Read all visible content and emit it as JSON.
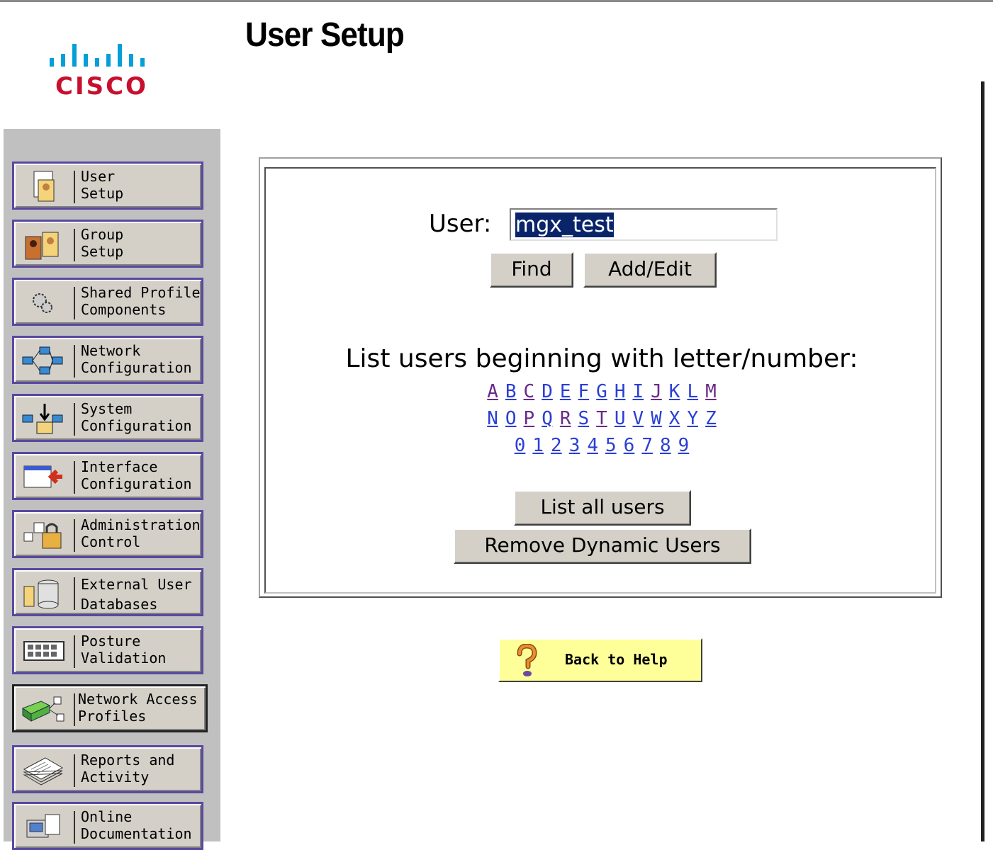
{
  "page": {
    "title": "User Setup"
  },
  "logo": {
    "text": "CISCO"
  },
  "sidebar": {
    "items": [
      {
        "label": "User\nSetup",
        "icon": "user-setup-icon"
      },
      {
        "label": "Group\nSetup",
        "icon": "group-setup-icon"
      },
      {
        "label": "Shared Profile\nComponents",
        "icon": "shared-profile-icon"
      },
      {
        "label": "Network\nConfiguration",
        "icon": "network-config-icon"
      },
      {
        "label": "System\nConfiguration",
        "icon": "system-config-icon"
      },
      {
        "label": "Interface\nConfiguration",
        "icon": "interface-config-icon"
      },
      {
        "label": "Administration\nControl",
        "icon": "admin-control-icon"
      },
      {
        "label": "External User\nDatabases",
        "icon": "external-db-icon"
      },
      {
        "label": "Posture\nValidation",
        "icon": "posture-icon"
      },
      {
        "label": "Network Access\nProfiles",
        "icon": "nap-icon"
      },
      {
        "label": "Reports and\nActivity",
        "icon": "reports-icon"
      },
      {
        "label": "Online\nDocumentation",
        "icon": "documentation-icon"
      }
    ]
  },
  "form": {
    "user_label": "User:",
    "user_value": "mgx_test",
    "find_label": "Find",
    "add_edit_label": "Add/Edit",
    "list_heading": "List users beginning with letter/number:",
    "row1": [
      "A",
      "B",
      "C",
      "D",
      "E",
      "F",
      "G",
      "H",
      "I",
      "J",
      "K",
      "L",
      "M"
    ],
    "row2": [
      "N",
      "O",
      "P",
      "Q",
      "R",
      "S",
      "T",
      "U",
      "V",
      "W",
      "X",
      "Y",
      "Z"
    ],
    "row3": [
      "0",
      "1",
      "2",
      "3",
      "4",
      "5",
      "6",
      "7",
      "8",
      "9"
    ],
    "list_all_label": "List all users",
    "remove_dynamic_label": "Remove Dynamic Users"
  },
  "help": {
    "label": "Back to Help"
  }
}
